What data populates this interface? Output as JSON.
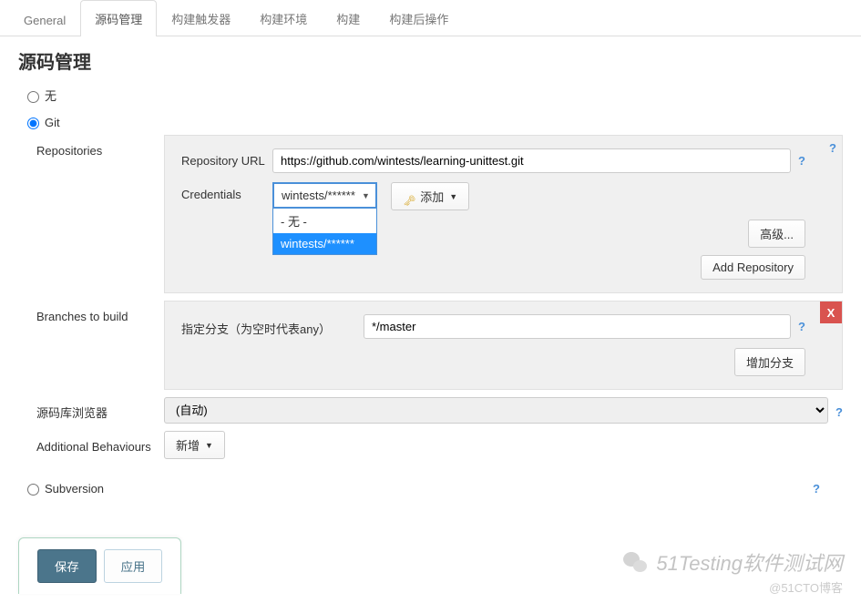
{
  "tabs": [
    {
      "label": "General"
    },
    {
      "label": "源码管理"
    },
    {
      "label": "构建触发器"
    },
    {
      "label": "构建环境"
    },
    {
      "label": "构建"
    },
    {
      "label": "构建后操作"
    }
  ],
  "section_title": "源码管理",
  "scm": {
    "none_label": "无",
    "git_label": "Git",
    "subversion_label": "Subversion"
  },
  "repo": {
    "side_label": "Repositories",
    "url_label": "Repository URL",
    "url_value": "https://github.com/wintests/learning-unittest.git",
    "cred_label": "Credentials",
    "cred_selected": "wintests/******",
    "cred_options": {
      "none": "- 无 -",
      "user": "wintests/******"
    },
    "add_cred": "添加",
    "advanced": "高级...",
    "add_repo": "Add Repository"
  },
  "branch": {
    "side_label": "Branches to build",
    "spec_label": "指定分支（为空时代表any）",
    "spec_value": "*/master",
    "add_branch": "增加分支",
    "delete_x": "X"
  },
  "browser": {
    "label": "源码库浏览器",
    "value": "(自动)"
  },
  "behaviours": {
    "label": "Additional Behaviours",
    "add": "新增"
  },
  "footer": {
    "save": "保存",
    "apply": "应用"
  },
  "help_icon": "?",
  "watermark": {
    "main": "51Testing软件测试网",
    "sub": "@51CTO博客"
  }
}
